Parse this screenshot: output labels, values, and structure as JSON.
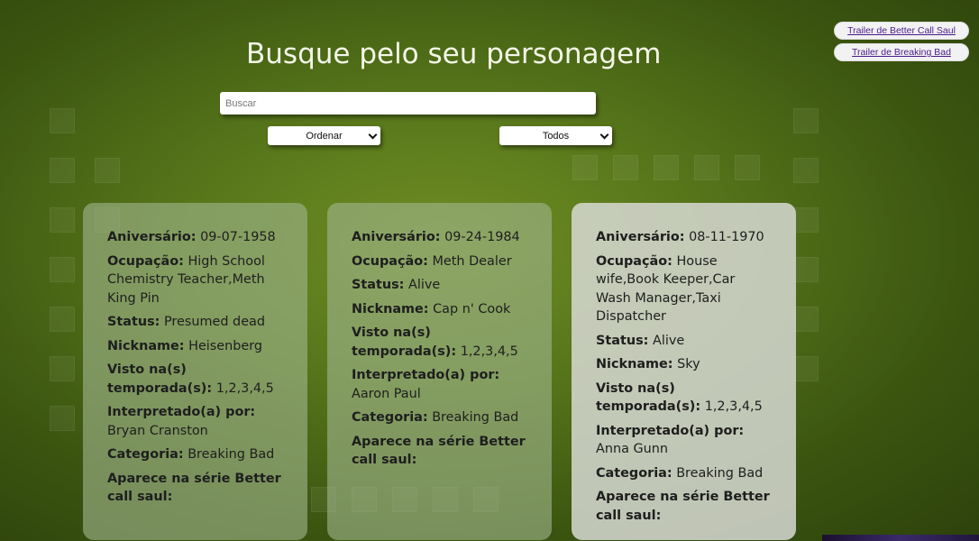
{
  "header": {
    "title": "Busque pelo seu personagem"
  },
  "search": {
    "placeholder": "Buscar",
    "value": ""
  },
  "filters": {
    "order_select": "Ordenar",
    "category_select": "Todos"
  },
  "trailers": {
    "better_call_saul": "Trailer de Better Call Saul",
    "breaking_bad": "Trailer de Breaking Bad"
  },
  "labels": {
    "birthday": "Aniversário:",
    "occupation": "Ocupação:",
    "status": "Status:",
    "nickname": "Nickname:",
    "seasons": "Visto na(s) temporada(s):",
    "portrayed": "Interpretado(a) por:",
    "category": "Categoria:",
    "bcs_appearance": "Aparece na série Better call saul:"
  },
  "cards": [
    {
      "birthday": "09-07-1958",
      "occupation": "High School Chemistry Teacher,Meth King Pin",
      "status": "Presumed dead",
      "nickname": "Heisenberg",
      "seasons": "1,2,3,4,5",
      "portrayed": "Bryan Cranston",
      "category": "Breaking Bad",
      "bcs_appearance": ""
    },
    {
      "birthday": "09-24-1984",
      "occupation": "Meth Dealer",
      "status": "Alive",
      "nickname": "Cap n' Cook",
      "seasons": "1,2,3,4,5",
      "portrayed": "Aaron Paul",
      "category": "Breaking Bad",
      "bcs_appearance": ""
    },
    {
      "birthday": "08-11-1970",
      "occupation": "House wife,Book Keeper,Car Wash Manager,Taxi Dispatcher",
      "status": "Alive",
      "nickname": "Sky",
      "seasons": "1,2,3,4,5",
      "portrayed": "Anna Gunn",
      "category": "Breaking Bad",
      "bcs_appearance": ""
    }
  ]
}
